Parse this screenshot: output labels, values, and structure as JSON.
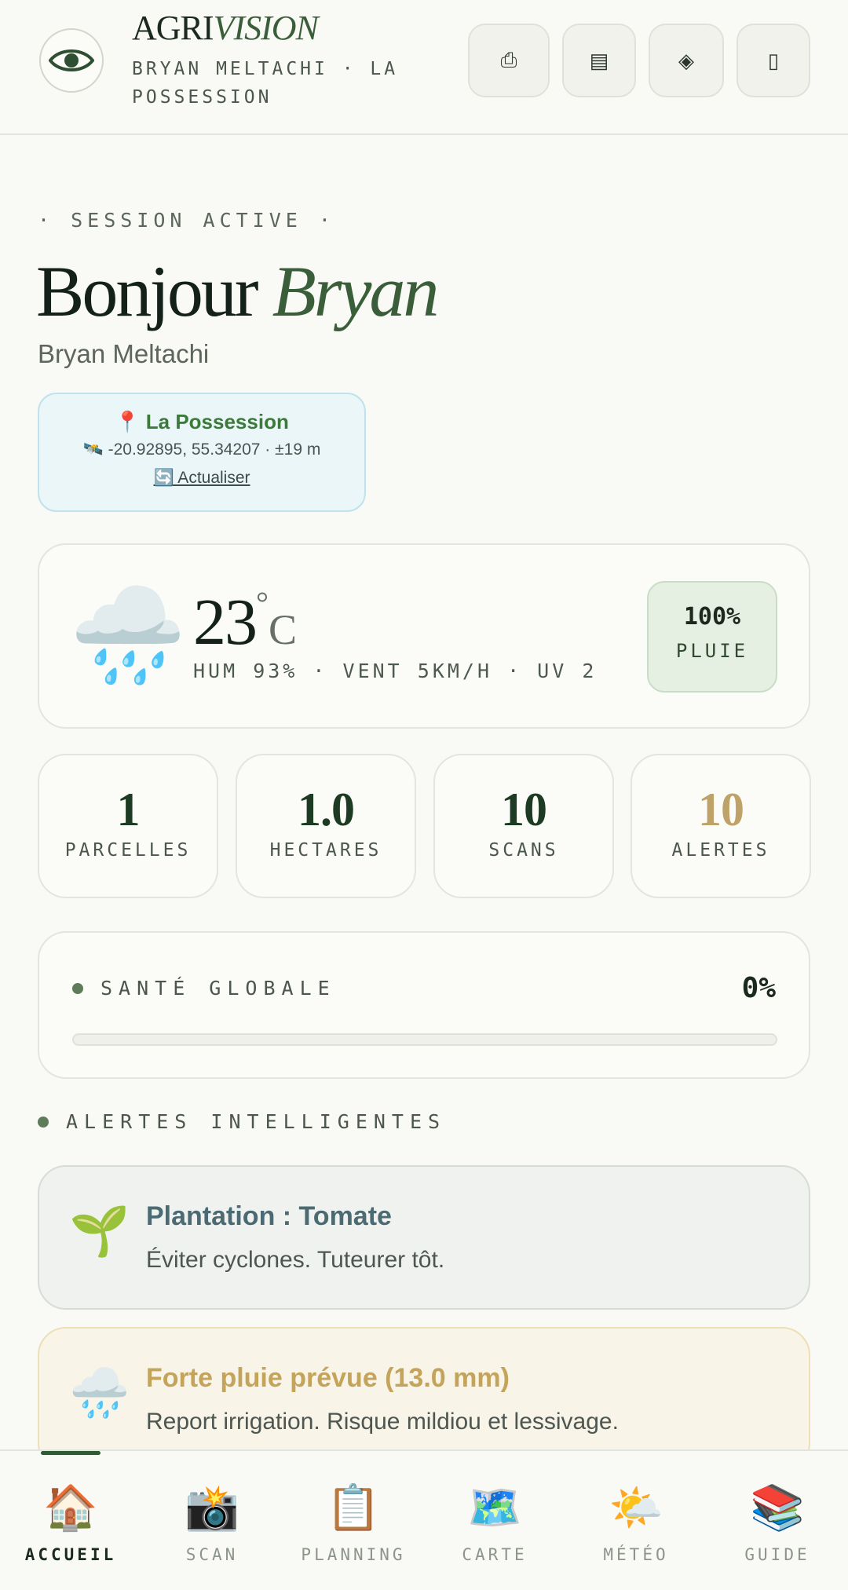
{
  "header": {
    "brand_part1": "AGRI",
    "brand_part2": "VISION",
    "subtitle": "BRYAN MELTACHI · LA POSSESSION",
    "buttons": [
      {
        "icon": "share-icon",
        "glyph": "⎙"
      },
      {
        "icon": "list-icon",
        "glyph": "▤"
      },
      {
        "icon": "diamond-icon",
        "glyph": "◈"
      },
      {
        "icon": "logout-icon",
        "glyph": "▯"
      }
    ]
  },
  "greeting": {
    "kicker": "· SESSION ACTIVE ·",
    "hello": "Bonjour",
    "first_name": "Bryan",
    "full_name": "Bryan Meltachi"
  },
  "location": {
    "pin": "📍",
    "name": "La Possession",
    "coords": "🛰️ -20.92895, 55.34207 · ±19 m",
    "refresh_label": "🔄 Actualiser"
  },
  "weather": {
    "icon": "🌧️",
    "temp": "23",
    "deg": "°",
    "unit": "C",
    "meta": "HUM 93% · VENT 5KM/H · UV 2",
    "rain_pct": "100%",
    "rain_label": "PLUIE"
  },
  "stats": [
    {
      "value": "1",
      "label": "PARCELLES",
      "color": "#1d3a22"
    },
    {
      "value": "1.0",
      "label": "HECTARES",
      "color": "#1d3a22"
    },
    {
      "value": "10",
      "label": "SCANS",
      "color": "#1d3a22"
    },
    {
      "value": "10",
      "label": "ALERTES",
      "color": "#bfa268"
    }
  ],
  "health": {
    "label": "SANTÉ GLOBALE",
    "pct_text": "0%",
    "value": 0
  },
  "alerts_section": {
    "title": "ALERTES INTELLIGENTES",
    "items": [
      {
        "icon": "🌱",
        "title": "Plantation : Tomate",
        "body": "Éviter cyclones. Tuteurer tôt."
      },
      {
        "icon": "🌧️",
        "title": "Forte pluie prévue (13.0 mm)",
        "body": "Report irrigation. Risque mildiou et lessivage."
      }
    ]
  },
  "nav": {
    "items": [
      {
        "icon": "🏠",
        "label": "ACCUEIL",
        "active": true
      },
      {
        "icon": "📸",
        "label": "SCAN"
      },
      {
        "icon": "📋",
        "label": "PLANNING"
      },
      {
        "icon": "🗺️",
        "label": "CARTE"
      },
      {
        "icon": "🌤️",
        "label": "MÉTÉO"
      },
      {
        "icon": "📚",
        "label": "GUIDE"
      }
    ]
  },
  "colors": {
    "accent": "#3b5e3a",
    "background": "#f9f9f5",
    "warning": "#c4a35a"
  }
}
